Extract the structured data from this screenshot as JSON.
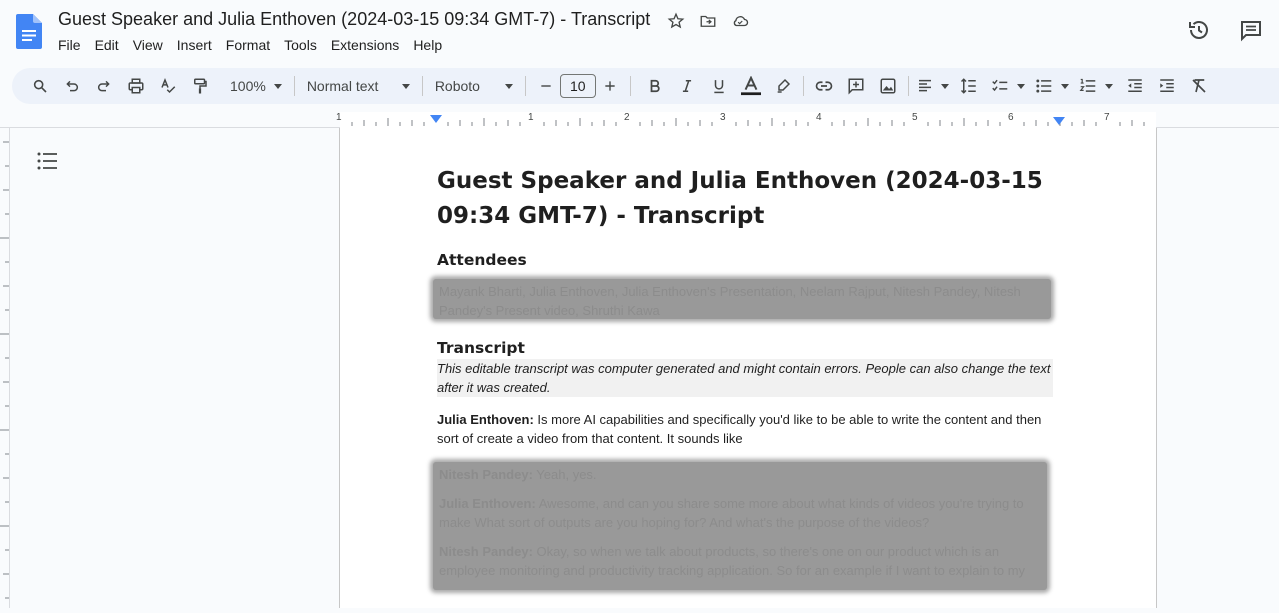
{
  "app": {
    "title": "Guest Speaker and Julia Enthoven (2024-03-15 09:34 GMT-7) - Transcript",
    "menu": [
      "File",
      "Edit",
      "View",
      "Insert",
      "Format",
      "Tools",
      "Extensions",
      "Help"
    ]
  },
  "toolbar": {
    "zoom": "100%",
    "style": "Normal text",
    "font": "Roboto",
    "font_size": "10"
  },
  "ruler": {
    "labels": [
      "1",
      "1",
      "2",
      "3",
      "4",
      "5",
      "6",
      "7"
    ]
  },
  "document": {
    "title": "Guest Speaker and Julia Enthoven (2024-03-15 09:34 GMT-7) - Transcript",
    "attendees_heading": "Attendees",
    "attendees_text": "Mayank Bharti, Julia Enthoven, Julia Enthoven's Presentation, Neelam Rajput, Nitesh Pandey, Nitesh Pandey's Present video, Shruthi Kawa",
    "transcript_heading": "Transcript",
    "disclaimer": "This editable transcript was computer generated and might contain errors. People can also change the text after it was created.",
    "entries": [
      {
        "speaker": "Julia Enthoven:",
        "text": " Is more AI capabilities and specifically you'd like to be able to write the content and then sort of create a video from that content. It sounds like"
      },
      {
        "speaker": "Nitesh Pandey:",
        "text": " Yeah, yes."
      },
      {
        "speaker": "Julia Enthoven:",
        "text": " Awesome, and can you share some more about what kinds of videos you're trying to make What sort of outputs are you hoping for? And what's the purpose of the videos?"
      },
      {
        "speaker": "Nitesh Pandey:",
        "text": " Okay, so when we talk about products, so there's one on our product which is an employee monitoring and productivity tracking application. So for an example if I want to explain to my"
      }
    ]
  }
}
